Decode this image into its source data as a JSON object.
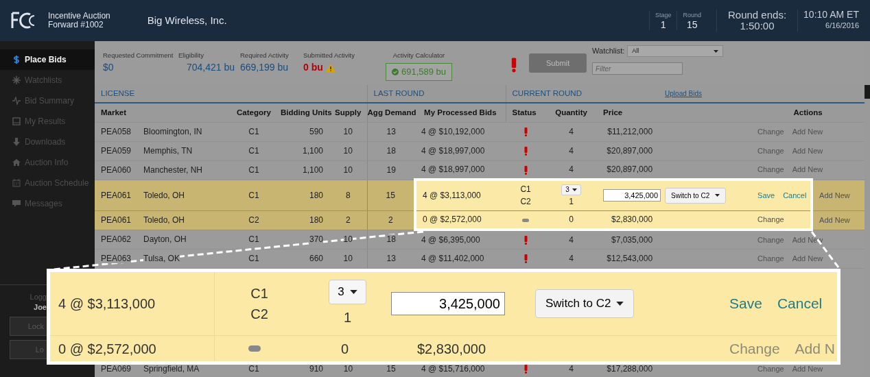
{
  "header": {
    "app_title": "Incentive Auction",
    "auction_name": "Forward #1002",
    "bidder": "Big Wireless, Inc.",
    "stage_label": "Stage",
    "stage": "1",
    "round_label": "Round",
    "round": "15",
    "round_ends_label": "Round ends:",
    "round_ends": "1:50:00",
    "time": "10:10 AM ET",
    "date": "6/16/2016"
  },
  "sidebar": {
    "items": [
      {
        "label": "Place Bids",
        "selected": true
      },
      {
        "label": "Watchlists",
        "selected": false
      },
      {
        "label": "Bid Summary",
        "selected": false
      },
      {
        "label": "My Results",
        "selected": false
      },
      {
        "label": "Downloads",
        "selected": false
      },
      {
        "label": "Auction Info",
        "selected": false
      },
      {
        "label": "Auction Schedule",
        "selected": false
      },
      {
        "label": "Messages",
        "selected": false
      }
    ],
    "footer": {
      "logged_label": "Logg",
      "user": "Joe",
      "buttons": [
        "Lock",
        "Lo"
      ]
    }
  },
  "summary": {
    "stats": [
      {
        "label": "Requested Commitment",
        "value": "$0",
        "warning": false
      },
      {
        "label": "Eligibility",
        "value": "704,421 bu",
        "warning": false
      },
      {
        "label": "Required Activity",
        "value": "669,199 bu",
        "warning": false
      },
      {
        "label": "Submitted Activity",
        "value": "0 bu",
        "warning": true
      }
    ],
    "calculator": {
      "label": "Activity Calculator",
      "value": "691,589 bu"
    },
    "submit": {
      "label": "Submit",
      "disabled": true
    },
    "watchlist": {
      "label": "Watchlist:",
      "value": "All"
    },
    "filter": {
      "placeholder": "Filter"
    }
  },
  "table": {
    "groups": [
      "LICENSE",
      "LAST ROUND",
      "CURRENT ROUND"
    ],
    "upload_link": "Upload Bids",
    "columns": [
      "Market",
      "Category",
      "Bidding Units",
      "Supply",
      "Agg Demand",
      "My Processed Bids",
      "Status",
      "Quantity",
      "Price",
      "Actions"
    ],
    "rows": [
      {
        "kind": "view",
        "market": "PEA058",
        "name": "Bloomington, IN",
        "category": "C1",
        "bidding_units": "590",
        "supply": "10",
        "agg_demand": "13",
        "processed_bids": "4 @ $10,192,000",
        "alert": true,
        "quantity": "4",
        "price": "$11,212,000",
        "actions": [
          "Change",
          "Add New"
        ],
        "highlighted": false,
        "focused": false
      },
      {
        "kind": "view",
        "market": "PEA059",
        "name": "Memphis, TN",
        "category": "C1",
        "bidding_units": "1,100",
        "supply": "10",
        "agg_demand": "18",
        "processed_bids": "4 @ $18,997,000",
        "alert": true,
        "quantity": "4",
        "price": "$20,897,000",
        "actions": [
          "Change",
          "Add New"
        ],
        "highlighted": false,
        "focused": false
      },
      {
        "kind": "view",
        "market": "PEA060",
        "name": "Manchester, NH",
        "category": "C1",
        "bidding_units": "1,100",
        "supply": "10",
        "agg_demand": "19",
        "processed_bids": "4 @ $18,997,000",
        "alert": true,
        "quantity": "4",
        "price": "$20,897,000",
        "actions": [
          "Change",
          "Add New"
        ],
        "highlighted": false,
        "focused": false
      },
      {
        "kind": "edit",
        "market": "PEA061",
        "name": "Toledo, OH",
        "category": "C1",
        "bidding_units": "180",
        "supply": "8",
        "agg_demand": "15",
        "processed_bids": "4 @ $3,113,000",
        "categories": [
          "C1",
          "C2"
        ],
        "quantity_select": "3",
        "quantity_other": "1",
        "price_input": "3,425,000",
        "switch_button": "Switch to C2",
        "actions": [
          "Save",
          "Cancel",
          "Add New"
        ],
        "highlighted": true,
        "focused": true
      },
      {
        "kind": "view",
        "market": "PEA061",
        "name": "Toledo, OH",
        "category": "C2",
        "bidding_units": "180",
        "supply": "2",
        "agg_demand": "2",
        "processed_bids": "0 @ $2,572,000",
        "alert": false,
        "quantity": "0",
        "price": "$2,830,000",
        "actions": [
          "Change",
          "Add New"
        ],
        "highlighted": true,
        "focused": true
      },
      {
        "kind": "view",
        "market": "PEA062",
        "name": "Dayton, OH",
        "category": "C1",
        "bidding_units": "370",
        "supply": "10",
        "agg_demand": "18",
        "processed_bids": "4 @ $6,395,000",
        "alert": true,
        "quantity": "4",
        "price": "$7,035,000",
        "actions": [
          "Change",
          "Add New"
        ],
        "highlighted": false,
        "focused": false
      },
      {
        "kind": "view",
        "market": "PEA063",
        "name": "Tulsa, OK",
        "category": "C1",
        "bidding_units": "660",
        "supply": "10",
        "agg_demand": "13",
        "processed_bids": "4 @ $11,402,000",
        "alert": true,
        "quantity": "4",
        "price": "$12,543,000",
        "actions": [
          "Change",
          "Add New"
        ],
        "highlighted": false,
        "focused": false
      },
      {
        "kind": "gap"
      },
      {
        "kind": "view",
        "market": "PEA069",
        "name": "Springfield, MA",
        "category": "C1",
        "bidding_units": "910",
        "supply": "10",
        "agg_demand": "15",
        "processed_bids": "4 @ $15,716,000",
        "alert": true,
        "quantity": "4",
        "price": "$17,288,000",
        "actions": [
          "Change",
          "Add New"
        ],
        "highlighted": false,
        "focused": false
      }
    ]
  },
  "magnifier": {
    "rows": [
      {
        "kind": "edit",
        "processed_bids": "4 @ $3,113,000",
        "categories": [
          "C1",
          "C2"
        ],
        "quantity_select": "3",
        "quantity_other": "1",
        "price_input": "3,425,000",
        "switch_button": "Switch to C2",
        "actions": [
          "Save",
          "Cancel"
        ]
      },
      {
        "kind": "view",
        "processed_bids": "0 @ $2,572,000",
        "alert": false,
        "quantity": "0",
        "price": "$2,830,000",
        "actions": [
          "Change",
          "Add N"
        ]
      }
    ]
  }
}
